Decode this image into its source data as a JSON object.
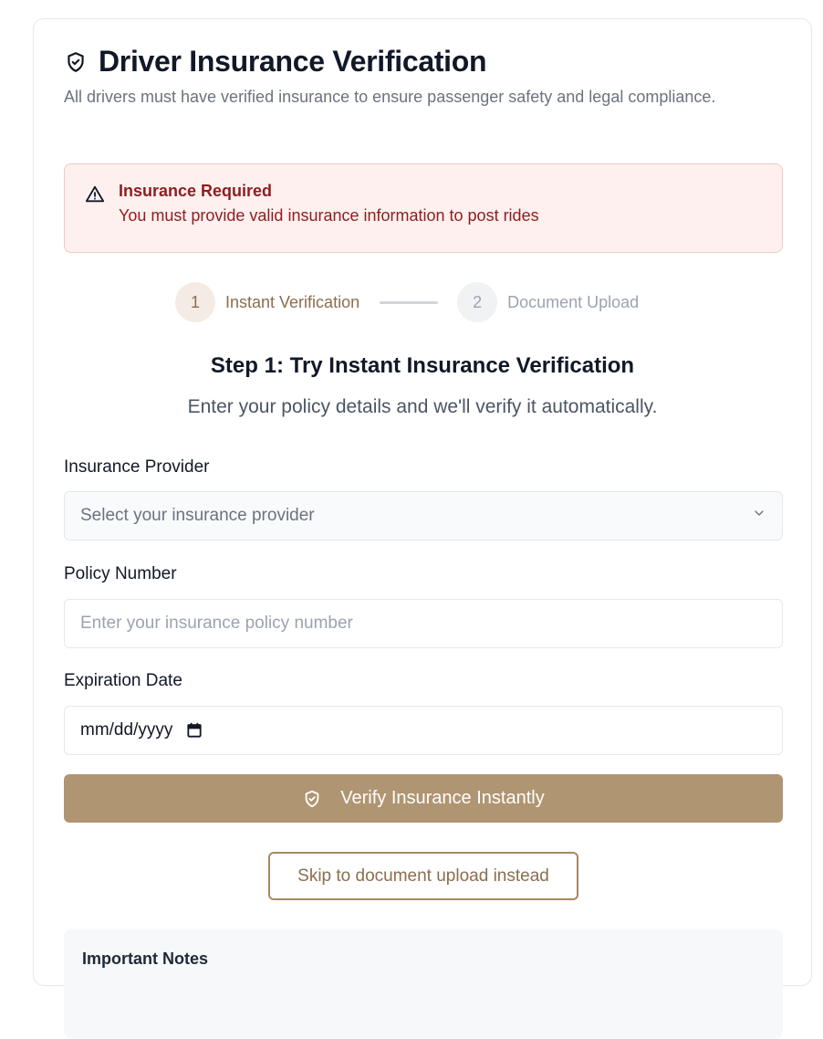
{
  "header": {
    "title": "Driver Insurance Verification",
    "subtitle": "All drivers must have verified insurance to ensure passenger safety and legal compliance."
  },
  "alert": {
    "title": "Insurance Required",
    "message": "You must provide valid insurance information to post rides"
  },
  "stepper": {
    "steps": [
      {
        "number": "1",
        "label": "Instant Verification",
        "state": "active"
      },
      {
        "number": "2",
        "label": "Document Upload",
        "state": "inactive"
      }
    ]
  },
  "step1": {
    "heading": "Step 1: Try Instant Insurance Verification",
    "description": "Enter your policy details and we'll verify it automatically."
  },
  "form": {
    "provider_label": "Insurance Provider",
    "provider_placeholder": "Select your insurance provider",
    "policy_label": "Policy Number",
    "policy_placeholder": "Enter your insurance policy number",
    "expiration_label": "Expiration Date",
    "expiration_placeholder": "mm/dd/yyyy"
  },
  "buttons": {
    "verify_label": "Verify Insurance Instantly",
    "skip_label": "Skip to document upload instead"
  },
  "notes": {
    "title": "Important Notes"
  },
  "colors": {
    "accent": "#b09572",
    "accent_text": "#8b6e4e",
    "alert_bg": "#fdf0ef",
    "alert_text": "#8f1d1d"
  },
  "icons": {
    "header": "shield-check-icon",
    "alert": "warning-triangle-icon",
    "select": "chevron-down-icon",
    "date": "calendar-icon",
    "verify": "shield-check-icon"
  }
}
